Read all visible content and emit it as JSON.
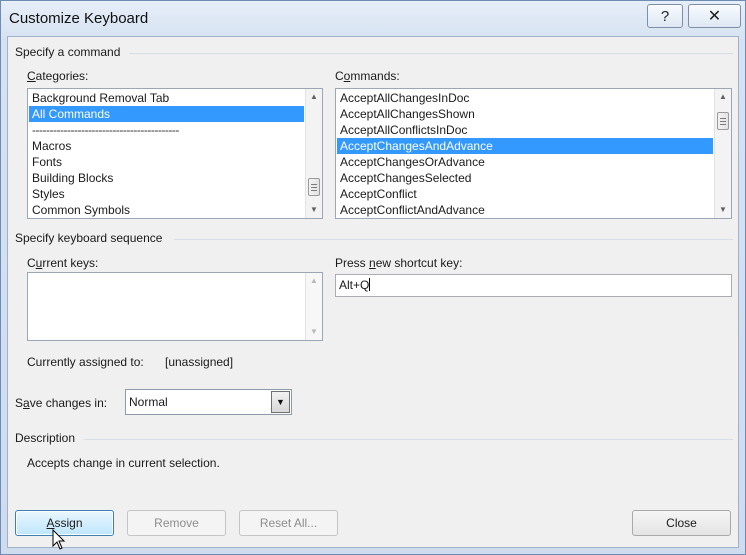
{
  "window": {
    "title": "Customize Keyboard",
    "help_icon": "question-mark-icon",
    "close_icon": "close-x-icon"
  },
  "specify_command": {
    "group_label": "Specify a command",
    "categories": {
      "label": "Categories:",
      "items": [
        "Background Removal Tab",
        "All Commands",
        "------------------------------------------",
        "Macros",
        "Fonts",
        "Building Blocks",
        "Styles",
        "Common Symbols"
      ],
      "selected": "All Commands"
    },
    "commands": {
      "label": "Commands:",
      "items": [
        "AcceptAllChangesInDoc",
        "AcceptAllChangesShown",
        "AcceptAllConflictsInDoc",
        "AcceptChangesAndAdvance",
        "AcceptChangesOrAdvance",
        "AcceptChangesSelected",
        "AcceptConflict",
        "AcceptConflictAndAdvance"
      ],
      "selected": "AcceptChangesAndAdvance"
    }
  },
  "keyboard_sequence": {
    "group_label": "Specify keyboard sequence",
    "current_keys_label": "Current keys:",
    "new_shortcut_label": "Press new shortcut key:",
    "new_shortcut_value": "Alt+Q",
    "currently_assigned_label": "Currently assigned to:",
    "currently_assigned_value": "[unassigned]"
  },
  "save_changes": {
    "label": "Save changes in:",
    "value": "Normal"
  },
  "description": {
    "group_label": "Description",
    "text": "Accepts change in current selection."
  },
  "buttons": {
    "assign": "Assign",
    "remove": "Remove",
    "reset_all": "Reset All...",
    "close": "Close"
  }
}
